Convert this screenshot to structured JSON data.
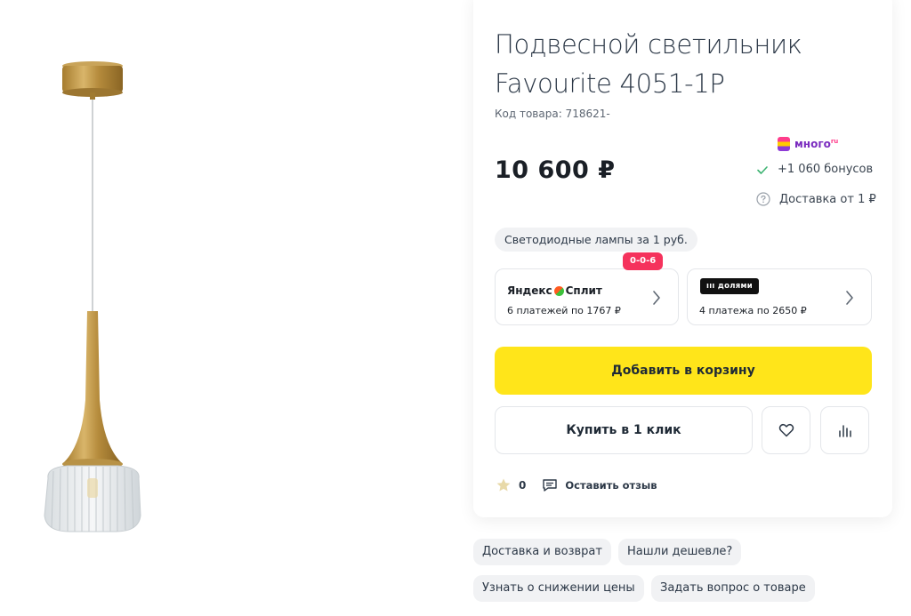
{
  "product": {
    "title": "Подвесной светильник Favourite 4051-1P",
    "sku_label": "Код товара: 718621-",
    "price": "10 600 ₽"
  },
  "loyalty": {
    "brand": "много",
    "brand_suffix": "ru",
    "bonus": "+1 060 бонусов",
    "delivery": "Доставка от 1 ₽"
  },
  "promo": {
    "label": "Светодиодные лампы за 1 руб."
  },
  "payments": [
    {
      "logo": "Яндекс Сплит",
      "badge": "0-0-6",
      "text": "6 платежей по 1767 ₽"
    },
    {
      "logo": "долями",
      "text": "4 платежа по 2650 ₽"
    }
  ],
  "actions": {
    "add_to_cart": "Добавить в корзину",
    "buy_one_click": "Купить в 1 клик"
  },
  "rating": {
    "count": "0",
    "review_link": "Оставить отзыв"
  },
  "chips": [
    "Доставка и возврат",
    "Нашли дешевле?",
    "Узнать о снижении цены",
    "Задать вопрос о товаре"
  ],
  "colors": {
    "cart_button": "#ffe51a",
    "badge": "#f5325c",
    "mnogo": "#7b2cbf"
  }
}
